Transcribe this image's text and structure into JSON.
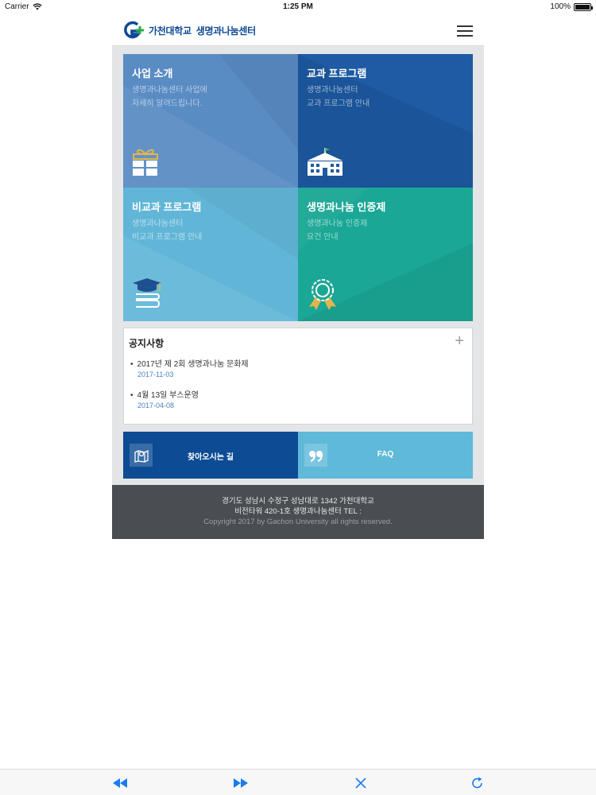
{
  "status_bar": {
    "carrier": "Carrier",
    "time": "1:25 PM",
    "battery": "100%"
  },
  "header": {
    "logo_name": "가천대학교",
    "logo_sub": "생명과나눔센터"
  },
  "tiles": [
    {
      "title": "사업 소개",
      "desc1": "생명과나눔센터 사업에",
      "desc2": "자세히 알려드립니다.",
      "icon": "gift-icon"
    },
    {
      "title": "교과 프로그램",
      "desc1": "생명과나눔센터",
      "desc2": "교과 프로그램 안내",
      "icon": "school-building-icon"
    },
    {
      "title": "비교과 프로그램",
      "desc1": "생명과나눔센터",
      "desc2": "비교과 프로그램 안내",
      "icon": "graduation-cap-books-icon"
    },
    {
      "title": "생명과나눔 인증제",
      "desc1": "생명과나눔 인증제",
      "desc2": "요건 안내",
      "icon": "award-badge-icon"
    }
  ],
  "notice": {
    "title": "공지사항",
    "items": [
      {
        "text": "2017년 제 2회 생명과나눔 문화제",
        "date": "2017-11-03"
      },
      {
        "text": "4월 13일 부스운영",
        "date": "2017-04-08"
      }
    ]
  },
  "actions": {
    "directions": "찾아오시는 길",
    "faq": "FAQ"
  },
  "footer": {
    "line1": "경기도 성남시 수정구 성남대로 1342 가천대학교",
    "line2": "비전타워 420-1호 생명과나눔센터 TEL :",
    "copyright": "Copyright 2017 by Gachon University all rights reserved."
  },
  "colors": {
    "brand_blue": "#0d4c94",
    "tile1": "#5a8cc4",
    "tile2": "#1e5ba4",
    "tile3": "#61b6d8",
    "tile4": "#1ba795",
    "toolbar_icon": "#1a7cf0"
  }
}
